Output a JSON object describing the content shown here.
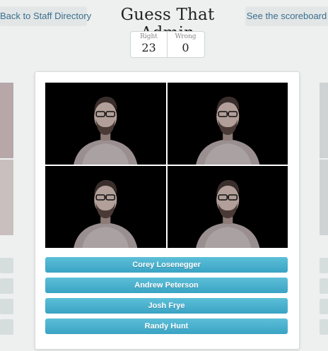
{
  "nav": {
    "back_label": "Back to Staff Directory",
    "scoreboard_label": "See the scoreboard"
  },
  "header": {
    "title": "Guess That Admin"
  },
  "score": {
    "right_label": "Right",
    "right_value": "23",
    "wrong_label": "Wrong",
    "wrong_value": "0"
  },
  "quiz": {
    "photos": [
      "portrait-1",
      "portrait-2",
      "portrait-3",
      "portrait-4"
    ],
    "answers": [
      "Corey Losenegger",
      "Andrew Peterson",
      "Josh Frye",
      "Randy Hunt"
    ]
  },
  "colors": {
    "answer_button": "#47b1cf",
    "title_text": "#222222",
    "link_text": "#3a6f8d"
  }
}
